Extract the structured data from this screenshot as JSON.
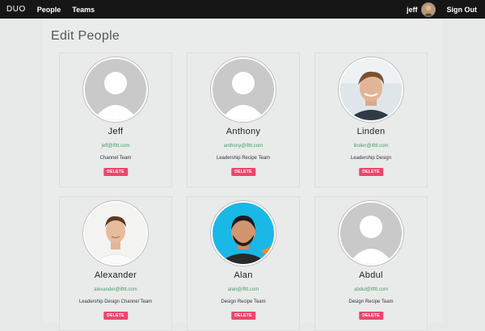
{
  "header": {
    "brand": "DUO",
    "nav": [
      {
        "label": "People"
      },
      {
        "label": "Teams"
      }
    ],
    "user": "jeff",
    "signout": "Sign Out"
  },
  "page": {
    "title": "Edit People"
  },
  "people": [
    {
      "name": "Jeff",
      "email": "jeff@ifttt.com",
      "teams": "Channel Team",
      "delete": "DELETE"
    },
    {
      "name": "Anthony",
      "email": "anthony@ifttt.com",
      "teams": "Leadership Recipe Team",
      "delete": "DELETE"
    },
    {
      "name": "Linden",
      "email": "linden@ifttt.com",
      "teams": "Leadership Design",
      "delete": "DELETE"
    },
    {
      "name": "Alexander",
      "email": "alexander@ifttt.com",
      "teams": "Leadership Design Channel Team",
      "delete": "DELETE"
    },
    {
      "name": "Alan",
      "email": "alan@ifttt.com",
      "teams": "Design Recipe Team",
      "delete": "DELETE"
    },
    {
      "name": "Abdul",
      "email": "abdul@ifttt.com",
      "teams": "Design Recipe Team",
      "delete": "DELETE"
    }
  ]
}
